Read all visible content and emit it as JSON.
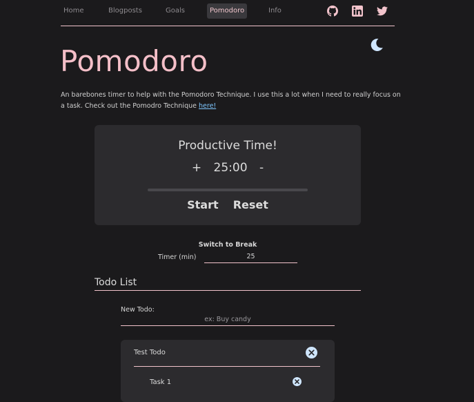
{
  "nav": {
    "items": [
      {
        "label": "Home"
      },
      {
        "label": "Blogposts"
      },
      {
        "label": "Goals"
      },
      {
        "label": "Pomodoro"
      },
      {
        "label": "Info"
      }
    ],
    "active": "Pomodoro",
    "social_icons": [
      "github-icon",
      "linkedin-icon",
      "twitter-icon"
    ]
  },
  "theme_toggle_icon": "moon-icon",
  "page": {
    "title": "Pomodoro",
    "intro_text": "An barebones timer to help with the Pomodoro Technique. I use this a lot when I need to really focus on a task. Check out the Pomodro Technique ",
    "intro_link": "here!"
  },
  "timer": {
    "title": "Productive Time!",
    "increment": "+",
    "display": "25:00",
    "decrement": "-",
    "progress": 0,
    "start_label": "Start",
    "reset_label": "Reset"
  },
  "settings": {
    "switch_label": "Switch to Break",
    "timer_label": "Timer (min)",
    "timer_value": "25"
  },
  "todo": {
    "heading": "Todo List",
    "new_label": "New Todo:",
    "new_placeholder": "ex: Buy candy",
    "lists": [
      {
        "title": "Test Todo",
        "tasks": [
          {
            "label": "Task 1"
          }
        ]
      }
    ]
  },
  "colors": {
    "background": "#1b1a1c",
    "accent_pink": "#f4bfc8",
    "card": "#2c2b2e",
    "icon_blue": "#cfe6ff"
  }
}
